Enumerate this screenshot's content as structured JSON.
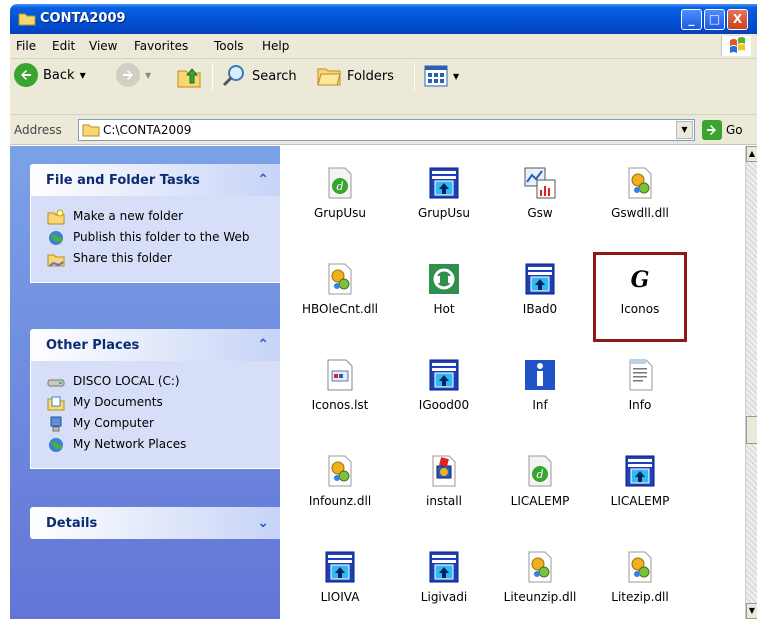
{
  "window": {
    "title": "CONTA2009",
    "controls": [
      "_",
      "□",
      "X"
    ]
  },
  "menu": [
    "File",
    "Edit",
    "View",
    "Favorites",
    "Tools",
    "Help"
  ],
  "toolbar": {
    "back": "Back",
    "search": "Search",
    "folders": "Folders"
  },
  "address": {
    "label": "Address",
    "path": "C:\\CONTA2009",
    "go": "Go"
  },
  "sidebar": {
    "file_tasks": {
      "title": "File and Folder Tasks",
      "items": [
        "Make a new folder",
        "Publish this folder to the Web",
        "Share this folder"
      ]
    },
    "other_places": {
      "title": "Other Places",
      "items": [
        "DISCO LOCAL (C:)",
        "My Documents",
        "My Computer",
        "My Network Places"
      ]
    },
    "details": {
      "title": "Details"
    }
  },
  "files": [
    {
      "name": "GrupUsu",
      "icon": "green-app-icon"
    },
    {
      "name": "GrupUsu",
      "icon": "window-app-icon"
    },
    {
      "name": "Gsw",
      "icon": "chart-app-icon"
    },
    {
      "name": "Gswdll.dll",
      "icon": "dll-icon"
    },
    {
      "name": "HBOleCnt.dll",
      "icon": "dll-icon"
    },
    {
      "name": "Hot",
      "icon": "headset-app-icon"
    },
    {
      "name": "IBad0",
      "icon": "window-app-icon"
    },
    {
      "name": "Iconos",
      "icon": "g-letter-icon"
    },
    {
      "name": "Iconos.lst",
      "icon": "list-file-icon"
    },
    {
      "name": "IGood00",
      "icon": "window-app-icon"
    },
    {
      "name": "Inf",
      "icon": "info-app-icon"
    },
    {
      "name": "Info",
      "icon": "text-file-icon"
    },
    {
      "name": "Infounz.dll",
      "icon": "dll-icon"
    },
    {
      "name": "install",
      "icon": "setup-icon"
    },
    {
      "name": "LICALEMP",
      "icon": "green-app-icon"
    },
    {
      "name": "LICALEMP",
      "icon": "window-app-icon"
    },
    {
      "name": "LIOIVA",
      "icon": "window-app-icon"
    },
    {
      "name": "Ligivadi",
      "icon": "window-app-icon"
    },
    {
      "name": "Liteunzip.dll",
      "icon": "dll-icon"
    },
    {
      "name": "Litezip.dll",
      "icon": "dll-icon"
    }
  ]
}
